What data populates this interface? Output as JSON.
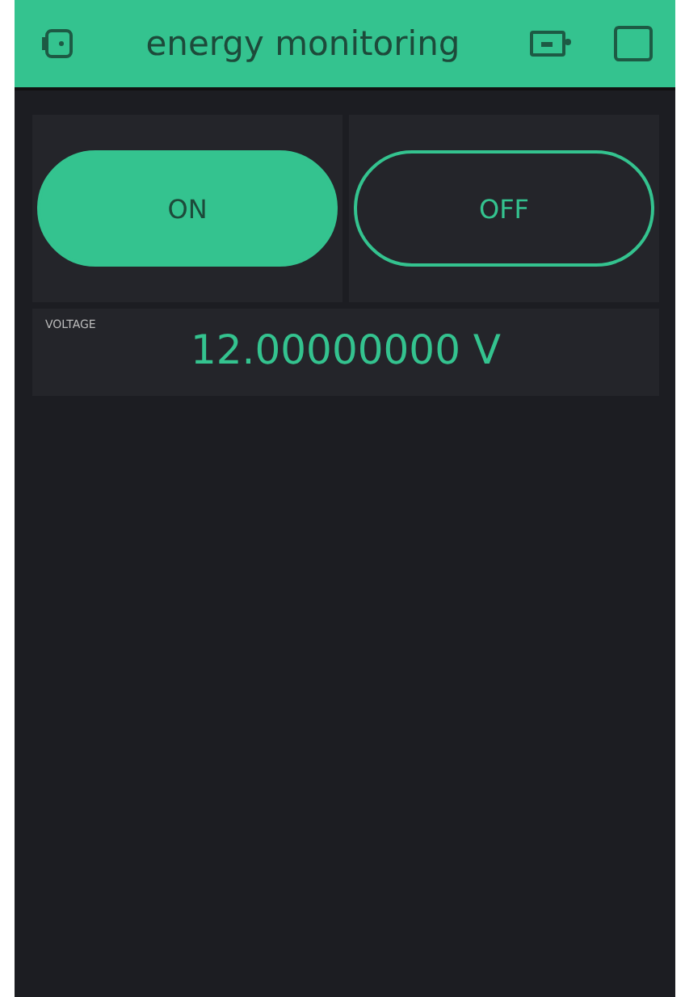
{
  "header": {
    "title": "energy monitoring"
  },
  "buttons": [
    {
      "label": "ON",
      "on": true
    },
    {
      "label": "OFF",
      "on": false
    }
  ],
  "display": {
    "label": "VOLTAGE",
    "value": "12.00000000 V"
  }
}
